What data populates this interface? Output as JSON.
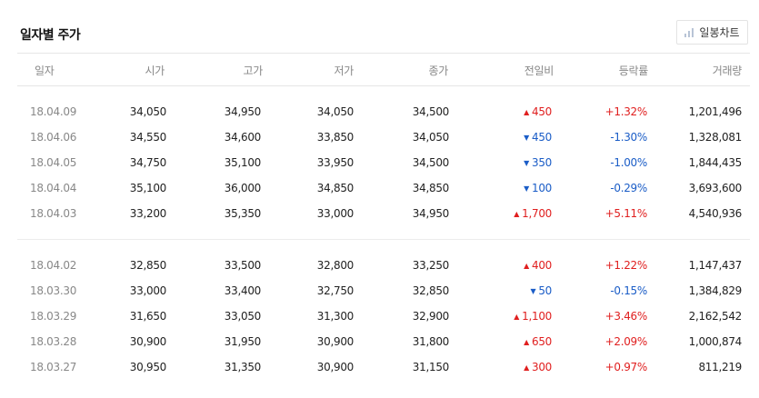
{
  "title": "일자별 주가",
  "chart_button": {
    "label": "일봉차트",
    "icon": "bar-chart-icon"
  },
  "columns": [
    "일자",
    "시가",
    "고가",
    "저가",
    "종가",
    "전일비",
    "등락률",
    "거래량"
  ],
  "colors": {
    "up": "#e01f1f",
    "down": "#1b5dc7"
  },
  "rows": [
    {
      "date": "18.04.09",
      "open": "34,050",
      "high": "34,950",
      "low": "34,050",
      "close": "34,500",
      "dir": "up",
      "change": "450",
      "rate": "+1.32%",
      "volume": "1,201,496"
    },
    {
      "date": "18.04.06",
      "open": "34,550",
      "high": "34,600",
      "low": "33,850",
      "close": "34,050",
      "dir": "down",
      "change": "450",
      "rate": "-1.30%",
      "volume": "1,328,081"
    },
    {
      "date": "18.04.05",
      "open": "34,750",
      "high": "35,100",
      "low": "33,950",
      "close": "34,500",
      "dir": "down",
      "change": "350",
      "rate": "-1.00%",
      "volume": "1,844,435"
    },
    {
      "date": "18.04.04",
      "open": "35,100",
      "high": "36,000",
      "low": "34,850",
      "close": "34,850",
      "dir": "down",
      "change": "100",
      "rate": "-0.29%",
      "volume": "3,693,600"
    },
    {
      "date": "18.04.03",
      "open": "33,200",
      "high": "35,350",
      "low": "33,000",
      "close": "34,950",
      "dir": "up",
      "change": "1,700",
      "rate": "+5.11%",
      "volume": "4,540,936"
    },
    {
      "date": "18.04.02",
      "open": "32,850",
      "high": "33,500",
      "low": "32,800",
      "close": "33,250",
      "dir": "up",
      "change": "400",
      "rate": "+1.22%",
      "volume": "1,147,437"
    },
    {
      "date": "18.03.30",
      "open": "33,000",
      "high": "33,400",
      "low": "32,750",
      "close": "32,850",
      "dir": "down",
      "change": "50",
      "rate": "-0.15%",
      "volume": "1,384,829"
    },
    {
      "date": "18.03.29",
      "open": "31,650",
      "high": "33,050",
      "low": "31,300",
      "close": "32,900",
      "dir": "up",
      "change": "1,100",
      "rate": "+3.46%",
      "volume": "2,162,542"
    },
    {
      "date": "18.03.28",
      "open": "30,900",
      "high": "31,950",
      "low": "30,900",
      "close": "31,800",
      "dir": "up",
      "change": "650",
      "rate": "+2.09%",
      "volume": "1,000,874"
    },
    {
      "date": "18.03.27",
      "open": "30,950",
      "high": "31,350",
      "low": "30,900",
      "close": "31,150",
      "dir": "up",
      "change": "300",
      "rate": "+0.97%",
      "volume": "811,219"
    }
  ]
}
